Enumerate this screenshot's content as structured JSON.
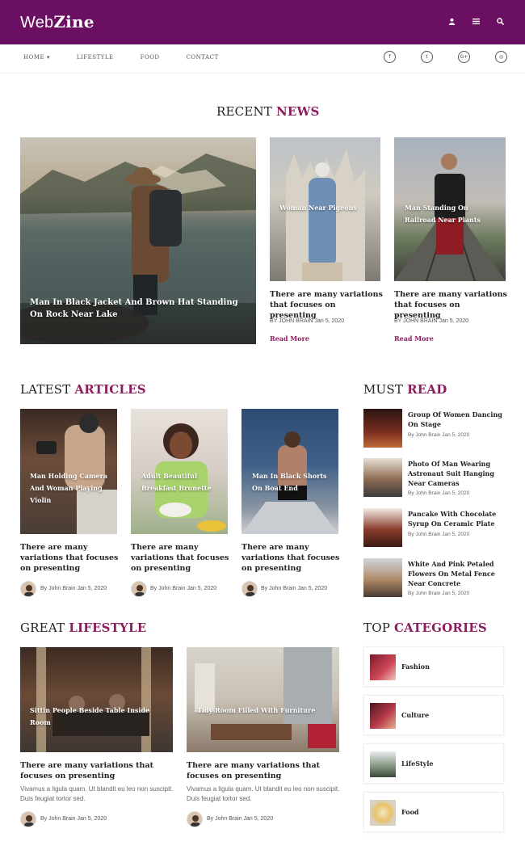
{
  "header": {
    "logo_web": "Web",
    "logo_zine": "Zine",
    "brand_color": "#6b0f62",
    "icons": [
      "user-icon",
      "menu-icon",
      "search-icon"
    ]
  },
  "nav": {
    "items": [
      "HOME ▾",
      "LIFESTYLE",
      "FOOD",
      "CONTACT"
    ],
    "social": [
      {
        "name": "facebook-icon",
        "glyph": "f"
      },
      {
        "name": "twitter-icon",
        "glyph": "t"
      },
      {
        "name": "google-plus-icon",
        "glyph": "G+"
      },
      {
        "name": "instagram-icon",
        "glyph": "◎"
      }
    ]
  },
  "accent_color": "#8b1e5e",
  "recent": {
    "title_plain": "RECENT ",
    "title_accent": "NEWS",
    "hero_caption": "Man In Black Jacket And Brown Hat Standing On Rock Near Lake",
    "cards": [
      {
        "caption": "Woman Near Pigeons",
        "headline": "There are many variations that focuses on presenting",
        "meta": "BY  JOHN BRAIN Jan 5, 2020",
        "read_more": "Read More"
      },
      {
        "caption": "Man Standing On Railroad Near Plants",
        "headline": "There are many variations that focuses on presenting",
        "meta": "BY  JOHN BRAIN Jan 5, 2020",
        "read_more": "Read More"
      }
    ]
  },
  "latest": {
    "title_plain": "LATEST ",
    "title_accent": "ARTICLES",
    "cards": [
      {
        "caption": "Man Holding Camera And Woman Playing Violin",
        "headline": "There are many variations that focuses on presenting",
        "meta": "By John Brain Jan 5, 2020"
      },
      {
        "caption": "Adult Beautiful Breakfast Brunette",
        "headline": "There are many variations that focuses on presenting",
        "meta": "By  John Brain Jan 5, 2020"
      },
      {
        "caption": "Man In Black Shorts On Boat End",
        "headline": "There are many variations that focuses on presenting",
        "meta": "By  John Brain Jan 5, 2020"
      }
    ]
  },
  "must_read": {
    "title_plain": "MUST ",
    "title_accent": "READ",
    "items": [
      {
        "title": "Group Of Women Dancing On Stage",
        "meta": "By John Brain Jan 5, 2020"
      },
      {
        "title": "Photo Of Man Wearing Astronaut Suit Hanging Near Cameras",
        "meta": "By John Brain Jan 5, 2020"
      },
      {
        "title": "Pancake With Chocolate Syrup On Ceramic Plate",
        "meta": "By John Brain Jan 5, 2020"
      },
      {
        "title": "White And Pink Petaled Flowers On Metal Fence Near Concrete",
        "meta": "By John Brain Jan 5, 2020"
      }
    ]
  },
  "lifestyle": {
    "title_plain": "GREAT ",
    "title_accent": "LIFESTYLE",
    "cards": [
      {
        "caption": "Sittin People Beside Table Inside Room",
        "headline": "There are many variations that focuses on presenting",
        "excerpt": "Vivamus a ligula quam. Ut blandit eu leo non suscipit. Duis feugiat tortor sed.",
        "meta": "By John Brain Jan 5, 2020"
      },
      {
        "caption": "Tidy Room Filled With Furniture",
        "headline": "There are many variations that focuses on presenting",
        "excerpt": "Vivamus a ligula quam. Ut blandit eu leo non suscipit. Duis feugiat tortor sed.",
        "meta": "By  John Brain Jan 5, 2020"
      }
    ]
  },
  "categories": {
    "title_plain": "TOP ",
    "title_accent": "CATEGORIES",
    "items": [
      "Fashion",
      "Culture",
      "LifeStyle",
      "Food"
    ]
  }
}
